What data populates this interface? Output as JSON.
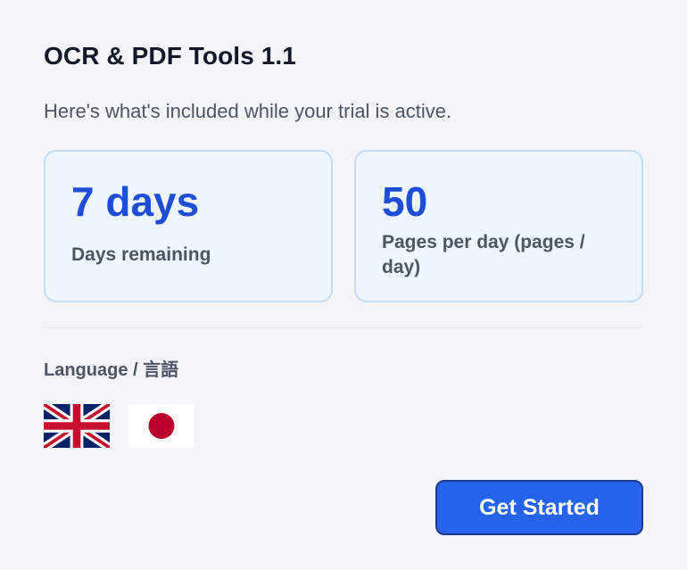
{
  "header": {
    "title": "OCR & PDF Tools 1.1",
    "subtitle": "Here's what's included while your trial is active."
  },
  "stats": [
    {
      "value": "7 days",
      "label": "Days remaining"
    },
    {
      "value": "50",
      "label": "Pages per day (pages / day)"
    }
  ],
  "language": {
    "label": "Language / 言語",
    "options": [
      {
        "icon": "uk-flag-icon",
        "code": "en"
      },
      {
        "icon": "japan-flag-icon",
        "code": "ja"
      }
    ]
  },
  "actions": {
    "primary_label": "Get Started"
  },
  "colors": {
    "accent": "#1d4ed8",
    "button": "#2563eb",
    "card_bg": "#eef6ff",
    "card_border": "#c2dcf6"
  }
}
